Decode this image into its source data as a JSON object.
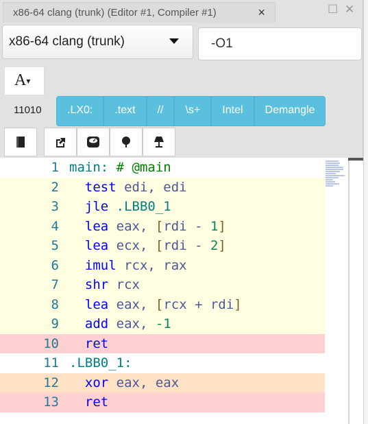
{
  "tab": {
    "title": "x86-64 clang (trunk) (Editor #1, Compiler #1)",
    "close": "×"
  },
  "window": {
    "maximize": "☐",
    "close": "✕"
  },
  "compiler": {
    "selected": "x86-64 clang (trunk)"
  },
  "options": {
    "value": "-O1"
  },
  "font_button": {
    "label": "A"
  },
  "binary_label": "11010",
  "filters": [
    ".LX0:",
    ".text",
    "//",
    "\\s+",
    "Intel",
    "Demangle"
  ],
  "tools": [
    "book-icon",
    "external-link-icon",
    "gauge-icon",
    "tree-icon",
    "lamp-icon"
  ],
  "code": [
    {
      "n": "1",
      "bg": "",
      "tokens": [
        [
          "l",
          "main:"
        ],
        [
          "p",
          " "
        ],
        [
          "c",
          "# @main"
        ]
      ]
    },
    {
      "n": "2",
      "bg": "y",
      "tokens": [
        [
          "p",
          "  "
        ],
        [
          "k",
          "test"
        ],
        [
          "p",
          " "
        ],
        [
          "r",
          "edi, edi"
        ]
      ]
    },
    {
      "n": "3",
      "bg": "y",
      "tokens": [
        [
          "p",
          "  "
        ],
        [
          "k",
          "jle"
        ],
        [
          "p",
          " "
        ],
        [
          "l",
          ".LBB0_1"
        ]
      ]
    },
    {
      "n": "4",
      "bg": "y",
      "tokens": [
        [
          "p",
          "  "
        ],
        [
          "k",
          "lea"
        ],
        [
          "p",
          " "
        ],
        [
          "r",
          "eax, "
        ],
        [
          "b",
          "["
        ],
        [
          "r",
          "rdi - "
        ],
        [
          "n",
          "1"
        ],
        [
          "b",
          "]"
        ]
      ]
    },
    {
      "n": "5",
      "bg": "y",
      "tokens": [
        [
          "p",
          "  "
        ],
        [
          "k",
          "lea"
        ],
        [
          "p",
          " "
        ],
        [
          "r",
          "ecx, "
        ],
        [
          "b",
          "["
        ],
        [
          "r",
          "rdi - "
        ],
        [
          "n",
          "2"
        ],
        [
          "b",
          "]"
        ]
      ]
    },
    {
      "n": "6",
      "bg": "y",
      "tokens": [
        [
          "p",
          "  "
        ],
        [
          "k",
          "imul"
        ],
        [
          "p",
          " "
        ],
        [
          "r",
          "rcx, rax"
        ]
      ]
    },
    {
      "n": "7",
      "bg": "y",
      "tokens": [
        [
          "p",
          "  "
        ],
        [
          "k",
          "shr"
        ],
        [
          "p",
          " "
        ],
        [
          "r",
          "rcx"
        ]
      ]
    },
    {
      "n": "8",
      "bg": "y",
      "tokens": [
        [
          "p",
          "  "
        ],
        [
          "k",
          "lea"
        ],
        [
          "p",
          " "
        ],
        [
          "r",
          "eax, "
        ],
        [
          "b",
          "["
        ],
        [
          "r",
          "rcx + rdi"
        ],
        [
          "b",
          "]"
        ]
      ]
    },
    {
      "n": "9",
      "bg": "y",
      "tokens": [
        [
          "p",
          "  "
        ],
        [
          "k",
          "add"
        ],
        [
          "p",
          " "
        ],
        [
          "r",
          "eax, "
        ],
        [
          "n",
          "-1"
        ]
      ]
    },
    {
      "n": "10",
      "bg": "r",
      "tokens": [
        [
          "p",
          "  "
        ],
        [
          "k",
          "ret"
        ]
      ]
    },
    {
      "n": "11",
      "bg": "",
      "tokens": [
        [
          "l",
          ".LBB0_1:"
        ]
      ]
    },
    {
      "n": "12",
      "bg": "o",
      "tokens": [
        [
          "p",
          "  "
        ],
        [
          "k",
          "xor"
        ],
        [
          "p",
          " "
        ],
        [
          "r",
          "eax, eax"
        ]
      ]
    },
    {
      "n": "13",
      "bg": "r",
      "tokens": [
        [
          "p",
          "  "
        ],
        [
          "k",
          "ret"
        ]
      ]
    }
  ]
}
